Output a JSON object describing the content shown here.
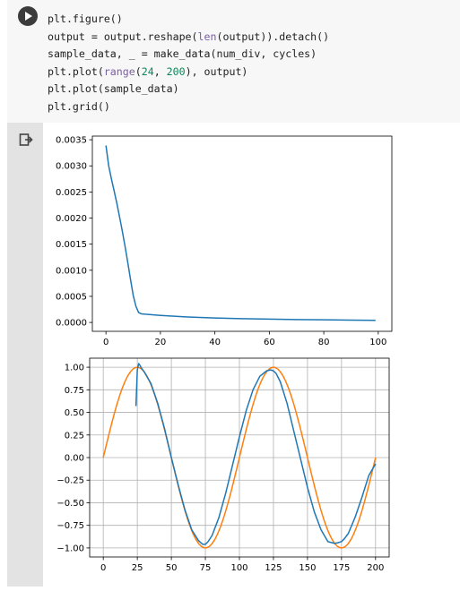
{
  "code_cell": {
    "run_button_icon": "play-icon",
    "lines": [
      [
        {
          "t": "plt.figure()",
          "c": ""
        }
      ],
      [
        {
          "t": "output = output.reshape(",
          "c": ""
        },
        {
          "t": "len",
          "c": "kw"
        },
        {
          "t": "(output)).detach()",
          "c": ""
        }
      ],
      [
        {
          "t": "sample_data, _ = make_data(num_div, cycles)",
          "c": ""
        }
      ],
      [
        {
          "t": "plt.plot(",
          "c": ""
        },
        {
          "t": "range",
          "c": "kw"
        },
        {
          "t": "(",
          "c": ""
        },
        {
          "t": "24",
          "c": "num"
        },
        {
          "t": ", ",
          "c": ""
        },
        {
          "t": "200",
          "c": "num"
        },
        {
          "t": "), output)",
          "c": ""
        }
      ],
      [
        {
          "t": "plt.plot(sample_data)",
          "c": ""
        }
      ],
      [
        {
          "t": "plt.grid()",
          "c": ""
        }
      ]
    ]
  },
  "output": {
    "icon": "output-redirect-icon"
  },
  "colors": {
    "blue": "#1f77b4",
    "orange": "#ff7f0e",
    "gutter": "#e3e3e3",
    "cell_bg": "#f7f7f7"
  },
  "chart_data": [
    {
      "type": "line",
      "grid": false,
      "xlim": [
        -5,
        105
      ],
      "ylim": [
        -0.00017,
        0.00357
      ],
      "xticks": [
        0,
        20,
        40,
        60,
        80,
        100
      ],
      "yticks": [
        0.0,
        0.0005,
        0.001,
        0.0015,
        0.002,
        0.0025,
        0.003,
        0.0035
      ],
      "xtick_labels": [
        "0",
        "20",
        "40",
        "60",
        "80",
        "100"
      ],
      "ytick_labels": [
        "0.0000",
        "0.0005",
        "0.0010",
        "0.0015",
        "0.0020",
        "0.0025",
        "0.0030",
        "0.0035"
      ],
      "series": [
        {
          "color": "#1f77b4",
          "x": [
            0,
            1,
            2,
            3,
            4,
            5,
            6,
            7,
            8,
            9,
            10,
            11,
            12,
            13,
            14,
            15,
            20,
            30,
            40,
            50,
            60,
            70,
            80,
            90,
            99
          ],
          "y": [
            0.00339,
            0.003,
            0.00275,
            0.00252,
            0.00228,
            0.00202,
            0.00175,
            0.00146,
            0.00115,
            0.00083,
            0.00052,
            0.00031,
            0.00019,
            0.000165,
            0.00016,
            0.000155,
            0.000135,
            0.000105,
            8.5e-05,
            7.2e-05,
            6.3e-05,
            5.6e-05,
            5e-05,
            4.5e-05,
            4e-05
          ]
        }
      ]
    },
    {
      "type": "line",
      "grid": true,
      "xlim": [
        -10,
        210
      ],
      "ylim": [
        -1.1,
        1.1
      ],
      "xticks": [
        0,
        25,
        50,
        75,
        100,
        125,
        150,
        175,
        200
      ],
      "yticks": [
        -1.0,
        -0.75,
        -0.5,
        -0.25,
        0.0,
        0.25,
        0.5,
        0.75,
        1.0
      ],
      "xtick_labels": [
        "0",
        "25",
        "50",
        "75",
        "100",
        "125",
        "150",
        "175",
        "200"
      ],
      "ytick_labels": [
        "−1.00",
        "−0.75",
        "−0.50",
        "−0.25",
        "0.00",
        "0.25",
        "0.50",
        "0.75",
        "1.00"
      ],
      "series": [
        {
          "color": "#ff7f0e",
          "x_start": 0,
          "x_end": 200,
          "x_step": 2,
          "function": "sin(2*pi*x/100)"
        },
        {
          "color": "#1f77b4",
          "x": [
            24,
            25,
            26,
            27,
            28,
            30,
            35,
            40,
            45,
            50,
            55,
            60,
            65,
            70,
            73,
            75,
            77,
            80,
            85,
            90,
            95,
            100,
            105,
            110,
            115,
            120,
            123,
            125,
            127,
            130,
            135,
            140,
            145,
            150,
            155,
            160,
            165,
            170,
            173,
            175,
            177,
            180,
            185,
            190,
            195,
            200
          ],
          "y": [
            0.57,
            0.97,
            1.04,
            1.02,
            0.99,
            0.95,
            0.82,
            0.6,
            0.32,
            0.0,
            -0.3,
            -0.58,
            -0.8,
            -0.92,
            -0.96,
            -0.96,
            -0.93,
            -0.86,
            -0.66,
            -0.39,
            -0.08,
            0.23,
            0.52,
            0.75,
            0.9,
            0.96,
            0.97,
            0.96,
            0.93,
            0.84,
            0.6,
            0.29,
            -0.02,
            -0.33,
            -0.6,
            -0.8,
            -0.93,
            -0.95,
            -0.94,
            -0.93,
            -0.9,
            -0.84,
            -0.66,
            -0.44,
            -0.2,
            -0.07
          ]
        }
      ]
    }
  ]
}
